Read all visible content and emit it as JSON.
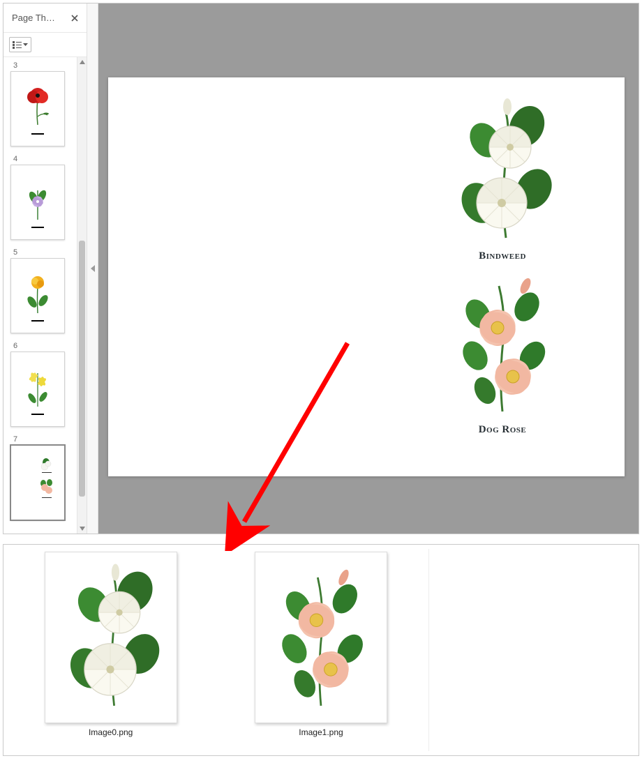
{
  "sidebar": {
    "title": "Page Th…",
    "thumbnails": [
      {
        "number": "3",
        "flower": "poppy",
        "selected": false
      },
      {
        "number": "4",
        "flower": "periwinkle",
        "selected": false
      },
      {
        "number": "5",
        "flower": "buttercup",
        "selected": false
      },
      {
        "number": "6",
        "flower": "jasmine",
        "selected": false
      },
      {
        "number": "7",
        "flower": "page7",
        "selected": true
      }
    ]
  },
  "page": {
    "figures": [
      {
        "caption": "Bindweed",
        "flower": "bindweed"
      },
      {
        "caption": "Dog Rose",
        "flower": "dogrose"
      }
    ]
  },
  "files": [
    {
      "name": "Image0.png",
      "flower": "bindweed"
    },
    {
      "name": "Image1.png",
      "flower": "dogrose"
    }
  ]
}
